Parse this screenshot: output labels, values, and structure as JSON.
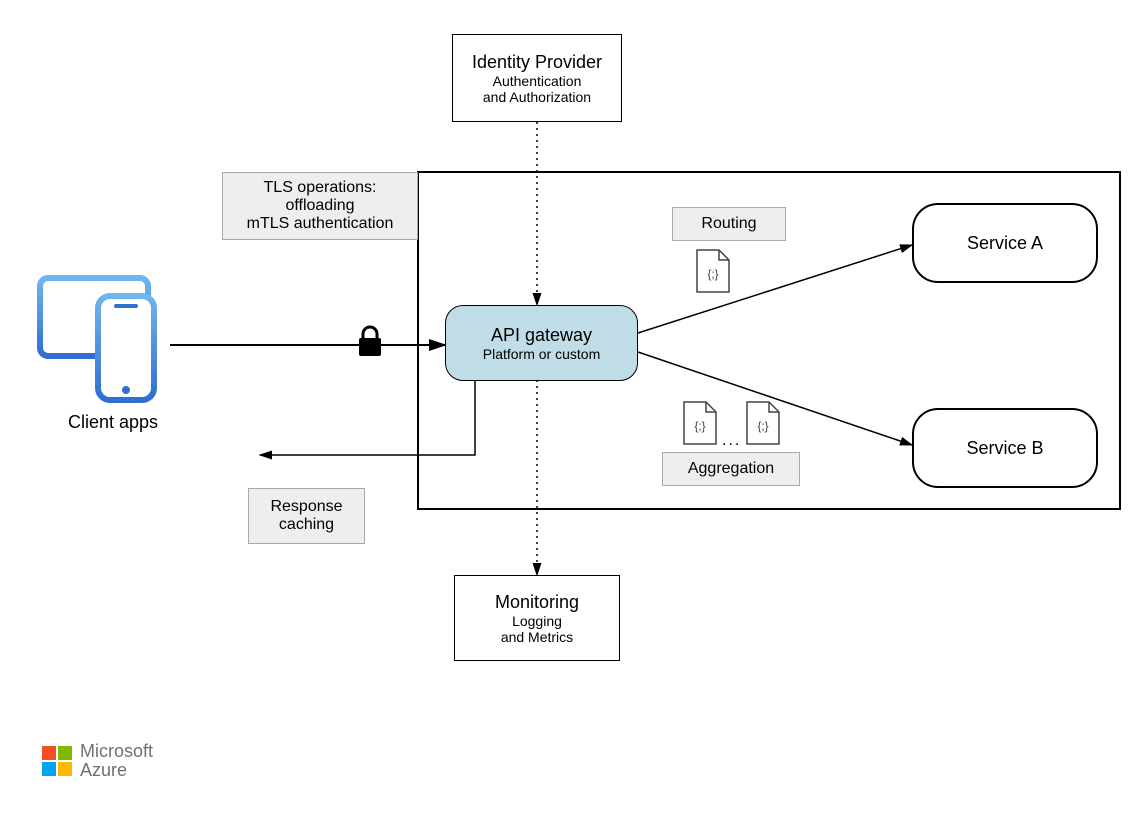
{
  "identity": {
    "title": "Identity Provider",
    "line1": "Authentication",
    "line2": "and Authorization"
  },
  "tls": {
    "line1": "TLS operations:",
    "line2": "offloading",
    "line3": "mTLS authentication"
  },
  "gateway": {
    "title": "API gateway",
    "sub": "Platform or custom"
  },
  "routing": {
    "label": "Routing"
  },
  "aggregation": {
    "label": "Aggregation",
    "ellipsis": "..."
  },
  "serviceA": {
    "label": "Service A"
  },
  "serviceB": {
    "label": "Service B"
  },
  "response": {
    "line1": "Response",
    "line2": "caching"
  },
  "monitoring": {
    "title": "Monitoring",
    "line1": "Logging",
    "line2": "and Metrics"
  },
  "client": {
    "label": "Client apps"
  },
  "brand": {
    "line1": "Microsoft",
    "line2": "Azure"
  },
  "colors": {
    "gateway_fill": "#c0dce6",
    "label_fill": "#eeeeee",
    "ms_red": "#f25022",
    "ms_green": "#7fba00",
    "ms_blue": "#00a4ef",
    "ms_yellow": "#ffb900",
    "device_blue_light": "#5ea6e6",
    "device_blue_dark": "#2f6fcf"
  }
}
